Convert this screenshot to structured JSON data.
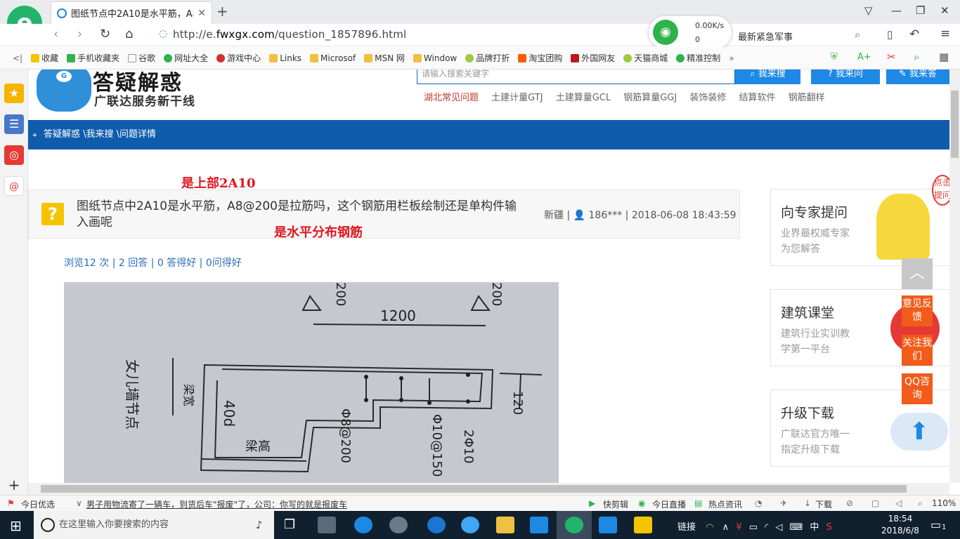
{
  "browser": {
    "tab_title": "图纸节点中2A10是水平筋，A8@",
    "url_prefix": "http://e.",
    "url_domain": "fwxgx.com",
    "url_path": "/question_1857896.html",
    "net_up": "0.00K/s",
    "net_down": "0",
    "hot_search": "最新紧急军事"
  },
  "bookmarks": [
    "收藏",
    "手机收藏夹",
    "谷歌",
    "网址大全",
    "游戏中心",
    "Links",
    "Microsof",
    "MSN 网",
    "Window",
    "品牌打折",
    "淘宝团购",
    "外国网友",
    "天猫商城",
    "精准控制"
  ],
  "header": {
    "brand_title": "答疑解惑",
    "brand_subtitle": "广联达服务新干线",
    "search_placeholder": "请输入搜索关键字",
    "btn_search": "我来搜",
    "btn_ask": "我来问",
    "btn_answer": "我来答",
    "hot_links": [
      "湖北常见问题",
      "土建计量GTJ",
      "土建算量GCL",
      "钢筋算量GGJ",
      "装饰装修",
      "结算软件",
      "钢筋翻样"
    ]
  },
  "breadcrumb": "答疑解惑 \\我来搜 \\问题详情",
  "annotations": {
    "top": "是上部2A10",
    "middle": "是水平分布钢筋"
  },
  "question": {
    "icon": "?",
    "title": "图纸节点中2A10是水平筋，A8@200是拉筋吗，这个钢筋用栏板绘制还是单构件输入画呢",
    "meta": "新疆 | 👤 186*** | 2018-06-08 18:43:59",
    "stats": "浏览12 次 | 2 回答 | 0 答得好 | 0问得好"
  },
  "drawing_labels": {
    "dim_1200": "1200",
    "dim_120": "120",
    "label_wall": "女儿墙节点",
    "label_width": "梁宽",
    "label_height": "梁高",
    "label_40d": "40d",
    "label_a8": "Φ8@200",
    "label_a10": "Φ10@150",
    "label_2a10": "2Φ10",
    "label_200a": "200",
    "label_200b": "200"
  },
  "sidebar_cards": [
    {
      "title": "向专家提问",
      "line1": "业界最权威专家",
      "line2": "为您解答"
    },
    {
      "title": "建筑课堂",
      "line1": "建筑行业实训教",
      "line2": "学第一平台"
    },
    {
      "title": "升级下载",
      "line1": "广联达官方唯一",
      "line2": "指定升级下载"
    }
  ],
  "float_buttons": [
    "意见反馈",
    "关注我们",
    "QQ咨询"
  ],
  "click_hint": "点击提问",
  "statusbar": {
    "today": "今日优选",
    "news": "男子用物流寄了一辆车，到货后车\"报废\"了，公司：你写的就是报废车",
    "quick_cut": "快剪辑",
    "live": "今日直播",
    "hot_news": "热点资讯",
    "download": "下载",
    "zoom": "110%"
  },
  "taskbar": {
    "search_placeholder": "在这里输入你要搜索的内容",
    "tray_link": "链接",
    "ime": "中",
    "time": "18:54",
    "date": "2018/6/8",
    "notify_count": "1"
  },
  "colors": {
    "brand_blue": "#0f5cad",
    "annotation_red": "#e0161f",
    "accent_orange": "#f25b1a",
    "browser_green": "#23b46b"
  }
}
